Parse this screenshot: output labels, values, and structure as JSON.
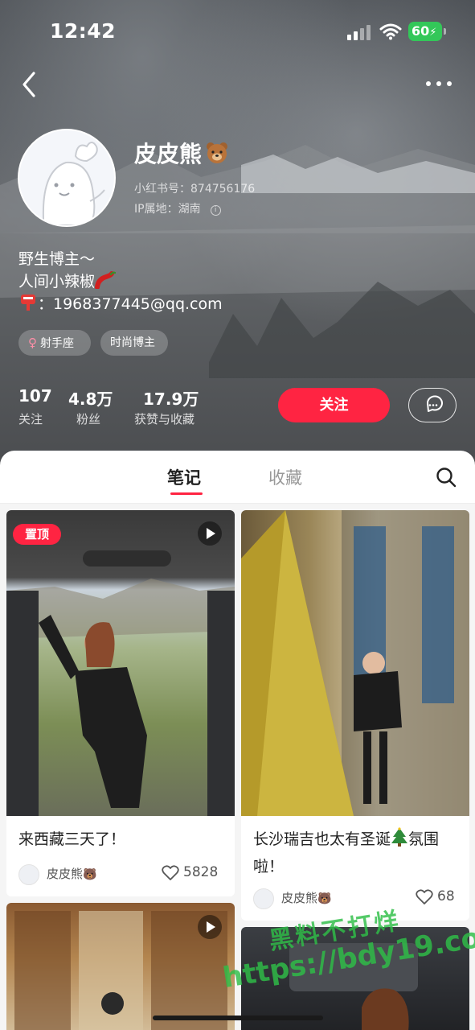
{
  "status_bar": {
    "time": "12:42",
    "battery": "60"
  },
  "profile": {
    "nickname": "皮皮熊",
    "xhs_id": "小红书号：874756176",
    "ip_location": "IP属地：湖南",
    "bio": [
      "野生博主～",
      "人间小辣椒",
      "：1968377445@qq.com"
    ],
    "tags": [
      {
        "label": "射手座",
        "icon": "female-icon"
      },
      {
        "label": "时尚博主"
      }
    ],
    "stats": [
      {
        "value": "107",
        "label": "关注"
      },
      {
        "value": "4.8万",
        "label": "粉丝"
      },
      {
        "value": "17.9万",
        "label": "获赞与收藏"
      }
    ],
    "follow_label": "关注"
  },
  "tabs": [
    {
      "label": "笔记",
      "active": true
    },
    {
      "label": "收藏",
      "active": false
    }
  ],
  "notes": [
    {
      "pinned_label": "置顶",
      "title": "来西藏三天了！",
      "author": "皮皮熊",
      "likes": "5828",
      "has_video": true
    },
    {
      "title": "长沙瑞吉也太有圣诞",
      "title_rest": "氛围啦！",
      "author": "皮皮熊",
      "likes": "68",
      "has_video": false
    },
    {
      "has_video": true
    },
    {
      "has_video": false
    }
  ],
  "watermark": {
    "line1": "黑料不打烊",
    "line2": "https://bdy19.co"
  },
  "colors": {
    "accent": "#ff2442",
    "battery": "#33c759",
    "watermark": "#2fbf48"
  }
}
